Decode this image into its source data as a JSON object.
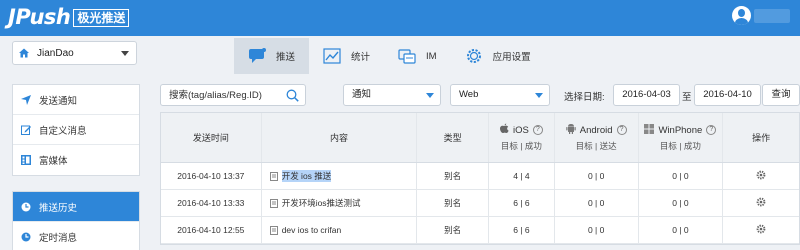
{
  "header": {
    "logo_text": "JPush",
    "logo_cn": "极光推送"
  },
  "app_selector": {
    "name": "JianDao"
  },
  "nav": {
    "tabs": [
      {
        "label": "推送",
        "icon": "chat-bubble-icon",
        "active": true
      },
      {
        "label": "统计",
        "icon": "chart-icon",
        "active": false
      },
      {
        "label": "IM",
        "icon": "im-icon",
        "active": false
      },
      {
        "label": "应用设置",
        "icon": "gear-icon",
        "active": false
      }
    ]
  },
  "sidebar": {
    "group1": [
      {
        "label": "发送通知",
        "icon": "send-icon"
      },
      {
        "label": "自定义消息",
        "icon": "edit-icon"
      },
      {
        "label": "富媒体",
        "icon": "rich-media-icon"
      }
    ],
    "group2": [
      {
        "label": "推送历史",
        "icon": "clock-icon",
        "active": true
      },
      {
        "label": "定时消息",
        "icon": "timer-icon"
      }
    ]
  },
  "filters": {
    "search_placeholder": "搜索(tag/alias/Reg.ID)",
    "type_select": "通知",
    "platform_select": "Web",
    "date_label": "选择日期:",
    "date_from": "2016-04-03",
    "date_to_label": "至",
    "date_to": "2016-04-10",
    "query_button": "查询"
  },
  "table": {
    "headers": {
      "time": "发送时间",
      "content": "内容",
      "type": "类型",
      "ios": "iOS",
      "ios_sub": "目标 | 成功",
      "android": "Android",
      "android_sub": "目标 | 送达",
      "winphone": "WinPhone",
      "winphone_sub": "目标 | 成功",
      "op": "操作"
    },
    "rows": [
      {
        "time": "2016-04-10 13:37",
        "content": "开发 ios 推送",
        "type": "别名",
        "ios": "4 | 4",
        "android": "0 | 0",
        "winphone": "0 | 0"
      },
      {
        "time": "2016-04-10 13:33",
        "content": "开发环境ios推送测试",
        "type": "别名",
        "ios": "6 | 6",
        "android": "0 | 0",
        "winphone": "0 | 0"
      },
      {
        "time": "2016-04-10 12:55",
        "content": "dev ios to crifan",
        "type": "别名",
        "ios": "6 | 6",
        "android": "0 | 0",
        "winphone": "0 | 0"
      }
    ]
  },
  "colors": {
    "brand": "#2e86d8",
    "background": "#eef1f5",
    "nav_active": "#d6dde5"
  }
}
